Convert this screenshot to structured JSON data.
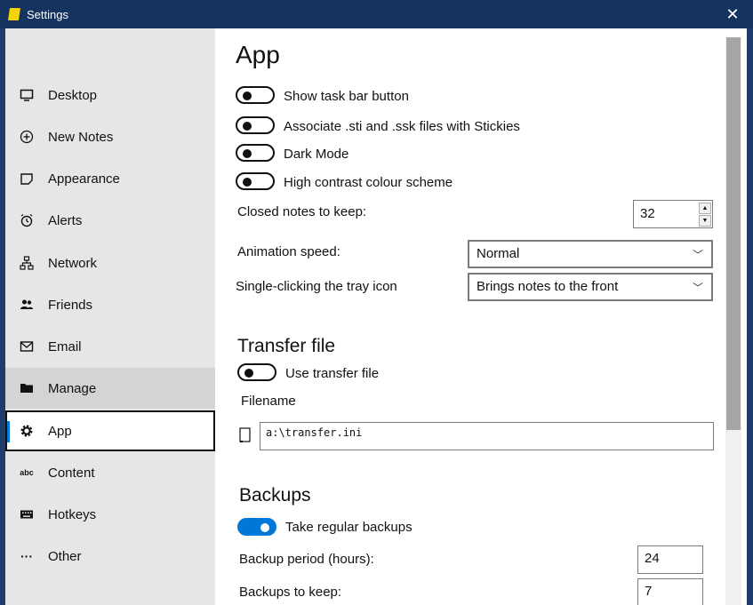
{
  "window": {
    "title": "Settings",
    "close_glyph": "✕"
  },
  "sidebar": {
    "items": [
      {
        "label": "Desktop",
        "icon": "monitor-icon"
      },
      {
        "label": "New Notes",
        "icon": "plus-circle-icon"
      },
      {
        "label": "Appearance",
        "icon": "note-icon"
      },
      {
        "label": "Alerts",
        "icon": "alarm-clock-icon"
      },
      {
        "label": "Network",
        "icon": "network-icon"
      },
      {
        "label": "Friends",
        "icon": "people-icon"
      },
      {
        "label": "Email",
        "icon": "mail-icon"
      },
      {
        "label": "Manage",
        "icon": "folder-icon"
      },
      {
        "label": "App",
        "icon": "gear-icon"
      },
      {
        "label": "Content",
        "icon": "abc-icon"
      },
      {
        "label": "Hotkeys",
        "icon": "keyboard-icon"
      },
      {
        "label": "Other",
        "icon": "more-icon"
      }
    ],
    "selected": "App",
    "hovered": "Manage"
  },
  "content": {
    "title": "App",
    "toggles": [
      {
        "label": "Show task bar button",
        "on": false
      },
      {
        "label": "Associate .sti and .ssk files with Stickies",
        "on": false
      },
      {
        "label": "Dark Mode",
        "on": false
      },
      {
        "label": "High contrast colour scheme",
        "on": false
      }
    ],
    "closed_notes": {
      "label": "Closed notes to keep:",
      "value": "32"
    },
    "animation_speed": {
      "label": "Animation speed:",
      "value": "Normal"
    },
    "tray_click": {
      "label": "Single-clicking the tray icon",
      "value": "Brings notes to the front"
    },
    "transfer": {
      "heading": "Transfer file",
      "toggle_label": "Use transfer file",
      "toggle_on": false,
      "filename_label": "Filename",
      "filename_value": "a:\\transfer.ini"
    },
    "backups": {
      "heading": "Backups",
      "toggle_label": "Take regular backups",
      "toggle_on": true,
      "period_label": "Backup period (hours):",
      "period_value": "24",
      "keep_label": "Backups to keep:",
      "keep_value": "7"
    }
  },
  "colors": {
    "accent": "#0078d7",
    "titlebar": "#15335f",
    "sidebar_bg": "#e6e6e6"
  }
}
